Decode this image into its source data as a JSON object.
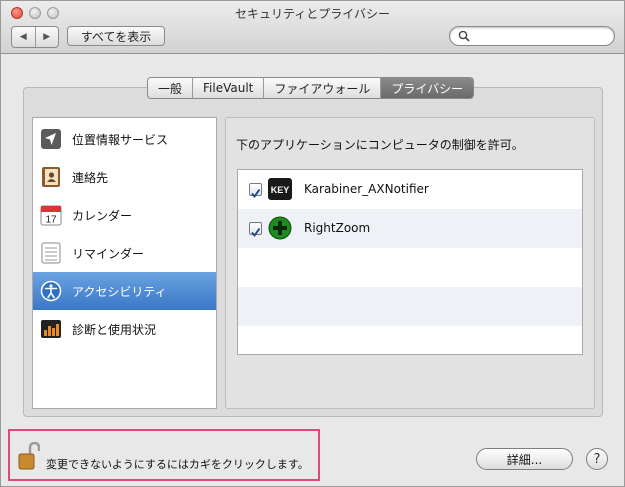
{
  "window": {
    "title": "セキュリティとプライバシー",
    "show_all_label": "すべてを表示",
    "nav_back": "◀",
    "nav_forward": "▶",
    "search": {
      "placeholder": "",
      "value": ""
    }
  },
  "tabs": [
    {
      "label": "一般",
      "selected": false
    },
    {
      "label": "FileVault",
      "selected": false
    },
    {
      "label": "ファイアウォール",
      "selected": false
    },
    {
      "label": "プライバシー",
      "selected": true
    }
  ],
  "sidebar": {
    "items": [
      {
        "label": "位置情報サービス",
        "icon": "location-arrow-icon",
        "selected": false
      },
      {
        "label": "連絡先",
        "icon": "contacts-icon",
        "selected": false
      },
      {
        "label": "カレンダー",
        "icon": "calendar-icon",
        "selected": false,
        "calendar_day": "17"
      },
      {
        "label": "リマインダー",
        "icon": "reminders-icon",
        "selected": false
      },
      {
        "label": "アクセシビリティ",
        "icon": "accessibility-icon",
        "selected": true
      },
      {
        "label": "診断と使用状況",
        "icon": "diagnostics-icon",
        "selected": false
      }
    ]
  },
  "pane": {
    "description": "下のアプリケーションにコンピュータの制御を許可。",
    "apps": [
      {
        "name": "Karabiner_AXNotifier",
        "checked": true,
        "icon": "key-app-icon",
        "icon_text": "KEY"
      },
      {
        "name": "RightZoom",
        "checked": true,
        "icon": "green-plus-icon"
      }
    ]
  },
  "footer": {
    "lock_text": "変更できないようにするにはカギをクリックします。",
    "details_label": "詳細...",
    "help_label": "?"
  },
  "colors": {
    "selection_blue": "#3a77c8",
    "highlight_frame": "#e0487b"
  }
}
